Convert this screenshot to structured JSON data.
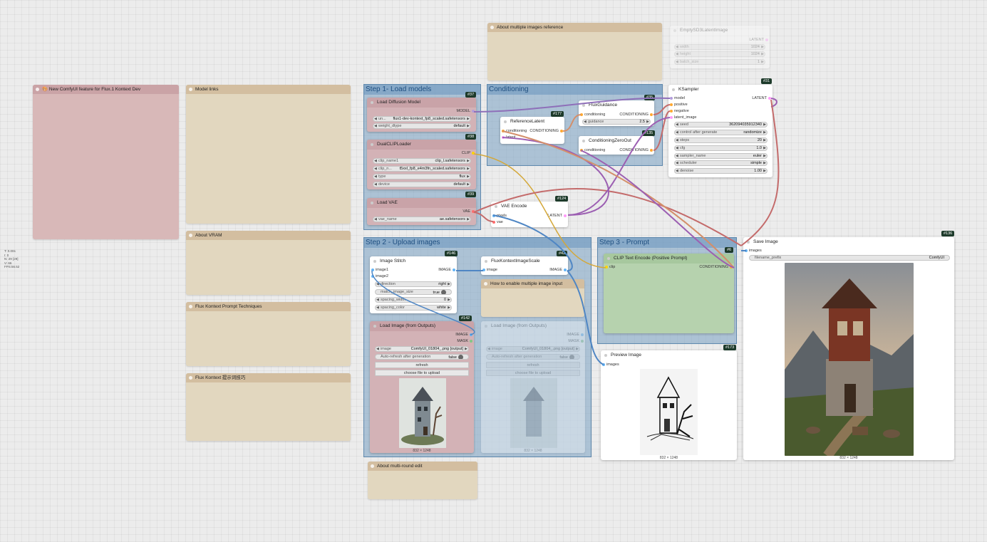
{
  "stats": [
    "T: 0.00s",
    "I: 0",
    "N: 29 [29]",
    "V: 66",
    "FPS:56.52"
  ],
  "notes": {
    "new_feature": "🎨 New ComfyUI feature for Flux.1 Kontext Dev",
    "model_links": "Model links",
    "about_vram": "About VRAM",
    "prompt_techniques": "Flux Kontext Prompt Techniques",
    "prompt_techniques_cn": "Flux Kontext 提示词技巧",
    "multiple_images_ref": "About multiple images reference",
    "multi_round_edit": "About multi-round edit",
    "enable_multiple_input": "How to enable multiple image input"
  },
  "groups": {
    "step1": "Step 1- Load models",
    "conditioning": "Conditioning",
    "step2": "Step 2 - Upload images",
    "step3": "Step 3 - Prompt"
  },
  "nodes": {
    "load_diffusion": {
      "title": "Load Diffusion Model",
      "badge": "#37",
      "output": "MODEL",
      "unet_label": "un...",
      "unet_value": "flux1-dev-kontext_fp8_scaled.safetensors",
      "dtype_label": "weight_dtype",
      "dtype_value": "default"
    },
    "dualclip": {
      "title": "DualCLIPLoader",
      "badge": "#38",
      "output": "CLIP",
      "clip1_label": "clip_name1",
      "clip1_value": "clip_l.safetensors",
      "clip2_label": "clip_n...",
      "clip2_value": "t5xxl_fp8_e4m3fn_scaled.safetensors",
      "type_label": "type",
      "type_value": "flux",
      "device_label": "device",
      "device_value": "default"
    },
    "load_vae": {
      "title": "Load VAE",
      "badge": "#39",
      "output": "VAE",
      "vae_label": "vae_name",
      "vae_value": "ae.safetensors"
    },
    "reference_latent": {
      "title": "ReferenceLatent",
      "badge": "#177",
      "in1": "conditioning",
      "in2": "latent",
      "output": "CONDITIONING"
    },
    "flux_guidance": {
      "title": "FluxGuidance",
      "badge": "#35",
      "in1": "conditioning",
      "output": "CONDITIONING",
      "g_label": "guidance",
      "g_value": "2.5"
    },
    "cond_zero_out": {
      "title": "ConditioningZeroOut",
      "badge": "#135",
      "in1": "conditioning",
      "output": "CONDITIONING"
    },
    "vae_encode": {
      "title": "VAE Encode",
      "badge": "#124",
      "in1": "pixels",
      "in2": "vae",
      "output": "LATENT"
    },
    "ksampler": {
      "title": "KSampler",
      "badge": "#31",
      "in1": "model",
      "in2": "positive",
      "in3": "negative",
      "in4": "latent_image",
      "output": "LATENT",
      "widgets": [
        {
          "label": "seed",
          "value": "362094035912340"
        },
        {
          "label": "control after generate",
          "value": "randomize"
        },
        {
          "label": "steps",
          "value": "20"
        },
        {
          "label": "cfg",
          "value": "1.0"
        },
        {
          "label": "sampler_name",
          "value": "euler"
        },
        {
          "label": "scheduler",
          "value": "simple"
        },
        {
          "label": "denoise",
          "value": "1.00"
        }
      ]
    },
    "empty_latent": {
      "title": "EmptySD3LatentImage",
      "output": "LATENT",
      "widgets": [
        {
          "label": "width",
          "value": "1024"
        },
        {
          "label": "height",
          "value": "1024"
        },
        {
          "label": "batch_size",
          "value": "1"
        }
      ]
    },
    "image_stitch": {
      "title": "Image Stitch",
      "badge": "#146",
      "in1": "image1",
      "in2": "image2",
      "output": "IMAGE",
      "widgets": [
        {
          "label": "direction",
          "value": "right"
        },
        {
          "label": "match_image_size",
          "value": "true"
        },
        {
          "label": "spacing_width",
          "value": "0"
        },
        {
          "label": "spacing_color",
          "value": "white"
        }
      ]
    },
    "flux_scale": {
      "title": "FluxKontextImageScale",
      "badge": "#42",
      "in1": "image",
      "output": "IMAGE"
    },
    "load_image": {
      "title": "Load Image (from Outputs)",
      "badge": "#142",
      "out1": "IMAGE",
      "out2": "MASK",
      "image_label": "image",
      "image_value": "ComfyUI_01804_.png [output]",
      "auto_label": "Auto-refresh after generation",
      "auto_value": "false",
      "refresh": "refresh",
      "choose": "choose file to upload",
      "caption": "832 × 1248"
    },
    "load_image_ghost": {
      "title": "Load Image (from Outputs)",
      "out1": "IMAGE",
      "out2": "MASK",
      "image_label": "image",
      "image_value": "ComfyUI_01804_.png [output]",
      "auto_label": "Auto-refresh after generation",
      "auto_value": "false",
      "refresh": "refresh",
      "choose": "choose file to upload",
      "caption": "832 × 1248"
    },
    "clip_text": {
      "title": "CLIP Text Encode (Positive Prompt)",
      "badge": "#6",
      "in1": "clip",
      "output": "CONDITIONING"
    },
    "preview": {
      "title": "Preview Image",
      "badge": "#173",
      "in1": "images",
      "caption": "832 × 1248"
    },
    "save_image": {
      "title": "Save Image",
      "badge": "#136",
      "in1": "images",
      "prefix_label": "filename_prefix",
      "prefix_value": "ComfyUI",
      "caption": "832 × 1248"
    }
  },
  "colors": {
    "model": "#b39ddb",
    "clip": "#ffd500",
    "vae": "#ff6e6e",
    "conditioning": "#ffa931",
    "latent": "#ff9cf9",
    "image": "#64b5f6"
  }
}
